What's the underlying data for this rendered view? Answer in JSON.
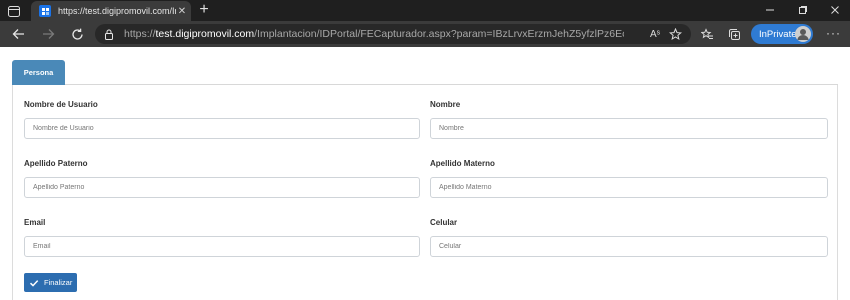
{
  "browser": {
    "tab_title": "https://test.digipromovil.com/Im",
    "tab_close": "✕",
    "new_tab": "+",
    "url_prefix": "https://",
    "url_host": "test.digipromovil.com",
    "url_path": "/Implantacion/IDPortal/FECapturador.aspx?param=IBzLrvxErzmJehZ5yfzlPz6EcojxKW+AxOPp...",
    "read_aloud": "Aˢ",
    "inprivate_label": "InPrivate",
    "more_label": "···",
    "accent_color": "#2f7bd3"
  },
  "form": {
    "tab_label": "Persona",
    "fields": {
      "nombre_usuario": {
        "label": "Nombre de Usuario",
        "placeholder": "Nombre de Usuario"
      },
      "nombre": {
        "label": "Nombre",
        "placeholder": "Nombre"
      },
      "apellido_paterno": {
        "label": "Apellido Paterno",
        "placeholder": "Apellido Paterno"
      },
      "apellido_materno": {
        "label": "Apellido Materno",
        "placeholder": "Apellido Materno"
      },
      "email": {
        "label": "Email",
        "placeholder": "Email"
      },
      "celular": {
        "label": "Celular",
        "placeholder": "Celular"
      }
    },
    "submit_label": "Finalizar",
    "primary_color": "#2c6db0",
    "tab_color": "#4a89b8"
  },
  "icons": {
    "tab_actions": "tab-actions-icon",
    "favicon": "site-favicon-icon",
    "back": "back-arrow-icon",
    "forward": "forward-arrow-icon",
    "refresh": "refresh-icon",
    "lock": "lock-icon",
    "favorite": "add-favorite-icon",
    "favorites": "favorites-icon",
    "collections": "collections-icon",
    "check": "check-icon"
  }
}
